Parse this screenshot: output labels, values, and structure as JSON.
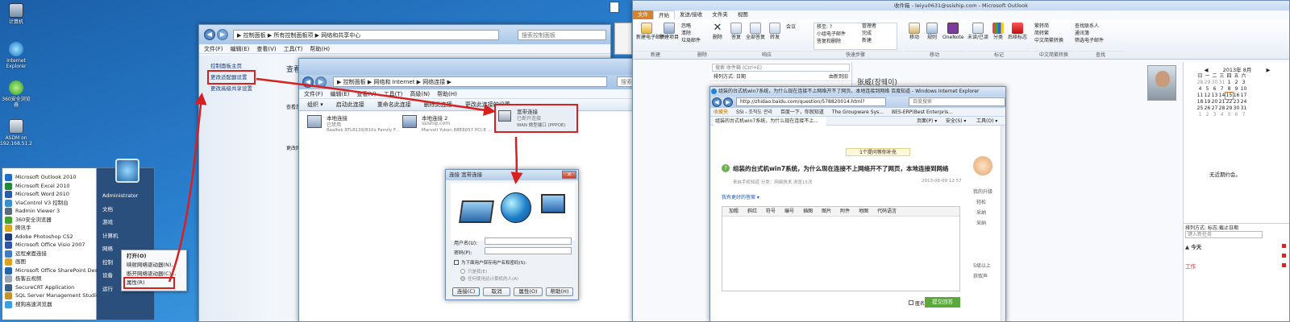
{
  "desktop": {
    "icons": [
      {
        "label": "计算机",
        "icon": "computer-icon"
      },
      {
        "label": "Internet Explorer",
        "icon": "ie-icon"
      },
      {
        "label": "360安全浏览器",
        "icon": "browser-icon"
      },
      {
        "label": "ASDM on 192.168.51.2",
        "icon": "asdm-icon"
      }
    ]
  },
  "start_menu": {
    "programs": [
      "Microsoft Outlook 2010",
      "Microsoft Excel 2010",
      "Microsoft Word 2010",
      "ViaControl V3 控制台",
      "Radmin Viewer 3",
      "360安全浏览器",
      "腾讯手",
      "Adobe Photoshop CS2",
      "Microsoft Office Visio 2007",
      "远程桌面连接",
      "画图",
      "Microsoft Office SharePoint Des...",
      "极客云视频",
      "SecureCRT Application",
      "SQL Server Management Studio...",
      "搜狗高速浏览器"
    ],
    "right": [
      "Administrator",
      "文档",
      "游戏",
      "计算机",
      "网络",
      "控制",
      "设备",
      "运行"
    ],
    "context": [
      "打开(O)",
      "映射网络驱动器(N)...",
      "断开网络驱动器(C)...",
      "属性(R)"
    ]
  },
  "nsc": {
    "address": "▶ 控制面板 ▶ 所有控制面板项 ▶ 网络和共享中心",
    "search": "搜索控制面板",
    "menu": [
      "文件(F)",
      "编辑(E)",
      "查看(V)",
      "工具(T)",
      "帮助(H)"
    ],
    "left": [
      "控制面板主页",
      "更改适配器设置",
      "更改高级共享设置"
    ],
    "heading": "查看",
    "side_labels": [
      "查看您",
      "更改网"
    ]
  },
  "netconn": {
    "address": "▶ 控制面板 ▶ 网络和 Internet ▶ 网络连接 ▶",
    "search": "搜索 网络连接",
    "menu": [
      "文件(F)",
      "编辑(E)",
      "查看(V)",
      "工具(T)",
      "高级(N)",
      "帮助(H)"
    ],
    "cmds": [
      "组织 ▾",
      "启动此连接",
      "重命名此连接",
      "删除此连接",
      "更改此连接的设置"
    ],
    "adapters": [
      {
        "name": "本地连接",
        "status": "已禁用",
        "device": "Realtek RTL8139/810x Family F..."
      },
      {
        "name": "本地连接 2",
        "status": "ssiship.com",
        "device": "Marvell Yukon 88E8057 PCI-E ..."
      },
      {
        "name": "宽带连接",
        "status": "已断开连接",
        "device": "WAN 微型端口 (PPPOE)"
      }
    ]
  },
  "dialog": {
    "title": "连接 宽带连接",
    "username_label": "用户名(U):",
    "password_label": "密码(P):",
    "save_label": "为下面用户保存用户名和密码(S):",
    "opt1": "只是我(E)",
    "opt2": "任何使用此计算机的人(A)",
    "buttons": [
      "连接(C)",
      "取消",
      "属性(O)",
      "帮助(H)"
    ]
  },
  "outlook": {
    "title": "收件箱 - leiyu0631@ssiship.com - Microsoft Outlook",
    "tabs": [
      "文件",
      "开始",
      "发送/接收",
      "文件夹",
      "视图"
    ],
    "buttons": [
      "新建电子邮件",
      "新建项目",
      "删除",
      "答复",
      "全部答复",
      "转发",
      "会议",
      "移动",
      "规则",
      "OneNote",
      "未读/已读",
      "分类",
      "后续标志",
      "通讯簿",
      "筛选电子邮件"
    ],
    "small": [
      "忽略",
      "清除",
      "垃圾邮件",
      "移至: ?",
      "小组电子邮件",
      "答复和删除",
      "管理者",
      "完成",
      "新建",
      "繁转简",
      "简转繁",
      "中文简繁转换",
      "查找联系人"
    ],
    "groups": [
      "新建",
      "删除",
      "响应",
      "快速步骤",
      "移动",
      "标记",
      "中文简繁转换",
      "查找"
    ],
    "search": "搜索 收件箱 (Ctrl+E)",
    "sort": "排列方式: 日期",
    "sort2": "由新到旧",
    "sender": "张威(장웨이)",
    "calendar_title": "2013年 8月",
    "weekdays": [
      "日",
      "一",
      "二",
      "三",
      "四",
      "五",
      "六"
    ],
    "days": [
      [
        28,
        29,
        30,
        31,
        1,
        2,
        3
      ],
      [
        4,
        5,
        6,
        7,
        8,
        9,
        10
      ],
      [
        11,
        12,
        13,
        14,
        15,
        16,
        17
      ],
      [
        18,
        19,
        20,
        21,
        22,
        23,
        24
      ],
      [
        25,
        26,
        27,
        28,
        29,
        30,
        31
      ],
      [
        1,
        2,
        3,
        4,
        5,
        6,
        7
      ]
    ],
    "no_appointments": "无近期约会。",
    "todo_sort": "排列方式: 标志:截止日期",
    "new_task": "键入新任务",
    "today": "今天",
    "work": "工作"
  },
  "ie": {
    "title": "组装的台式机win7系统，为什么现在连接不上网络开不了网页，本地连接到网络 百度知道 - Windows Internet Explorer",
    "url": "http://zhidao.baidu.com/question/578820014.html?",
    "search": "百度搜索",
    "favorites": [
      "收藏夹",
      "SSI - 조직도 관리",
      "百度一下，你就知道",
      "The Groupware Sys...",
      "BES-ERP(Best Enterpris..."
    ],
    "tab": "组装的台式机win7系统，为什么现在连接不上...",
    "tools": [
      "页面(P) ▾",
      "安全(S) ▾",
      "工具(O) ▾"
    ],
    "notice": "1个提问等你补充",
    "question": "组装的台式机win7系统，为什么现在连接不上网络开不了网页，本地连接到网络",
    "meta": "来自手机知道   分类：网络技术   浏览15次",
    "date": "2013-08-09 12:57",
    "answer_label": "我有更好的答案 ▾",
    "editor_tools": [
      "加粗",
      "斜红",
      "符号",
      "编号",
      "插图",
      "图片",
      "附件",
      "地图",
      "代码语言"
    ],
    "anon": "匿名",
    "submit": "提交回答",
    "side": [
      "我的升级",
      "轻松",
      "采纳",
      "采纳"
    ],
    "side2": [
      "5级以上",
      "获取声"
    ]
  }
}
